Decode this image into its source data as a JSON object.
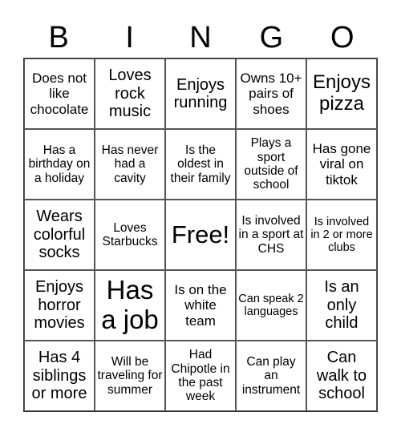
{
  "header": [
    "B",
    "I",
    "N",
    "G",
    "O"
  ],
  "cells": [
    "Does not like chocolate",
    "Loves rock music",
    "Enjoys running",
    "Owns 10+ pairs of shoes",
    "Enjoys pizza",
    "Has a birthday on a holiday",
    "Has never had a cavity",
    "Is the oldest in their family",
    "Plays a sport outside of school",
    "Has gone viral on tiktok",
    "Wears colorful socks",
    "Loves Starbucks",
    "Free!",
    "Is involved in a sport at CHS",
    "Is involved in 2 or more clubs",
    "Enjoys horror movies",
    "Has a job",
    "Is on the white team",
    "Can speak 2 languages",
    "Is an only child",
    "Has 4 siblings or more",
    "Will be traveling for summer",
    "Had Chipotle in the past week",
    "Can play an instrument",
    "Can walk to school"
  ]
}
